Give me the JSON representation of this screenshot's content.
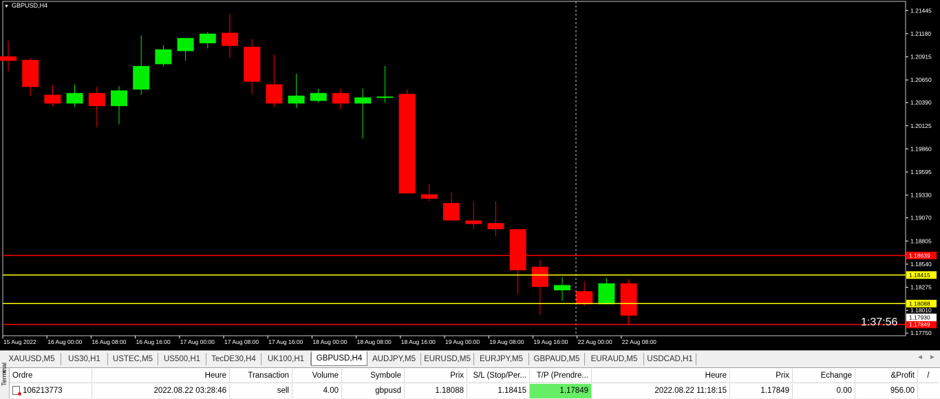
{
  "chart": {
    "title": "GBPUSD,H4",
    "timer": "1:37:56",
    "colors": {
      "bull": "#00ee00",
      "bear": "#ff0000",
      "wick_bull": "#00ee00",
      "wick_bear": "#ff0000",
      "level_red": "#ff0000",
      "level_yellow": "#ffff00",
      "axis": "#ffffff"
    },
    "price_labels": [
      "1.21445",
      "1.21180",
      "1.20915",
      "1.20650",
      "1.20390",
      "1.20125",
      "1.19860",
      "1.19595",
      "1.19330",
      "1.19070",
      "1.18805",
      "1.18540",
      "1.18275",
      "1.18010",
      "1.17750"
    ],
    "time_labels": [
      "15 Aug 2022",
      "16 Aug 00:00",
      "16 Aug 08:00",
      "16 Aug 16:00",
      "17 Aug 00:00",
      "17 Aug 08:00",
      "17 Aug 16:00",
      "18 Aug 00:00",
      "18 Aug 08:00",
      "18 Aug 16:00",
      "19 Aug 00:00",
      "19 Aug 08:00",
      "19 Aug 16:00",
      "22 Aug 00:00",
      "22 Aug 08:00"
    ],
    "levels": [
      {
        "price": 1.18639,
        "label": "1.18639",
        "color": "red"
      },
      {
        "price": 1.18415,
        "label": "1.18415",
        "color": "yellow"
      },
      {
        "price": 1.18088,
        "label": "1.18088",
        "color": "yellow"
      },
      {
        "price": 1.17849,
        "label": "1.17849",
        "color": "red"
      }
    ],
    "current_price": {
      "price": 1.1793,
      "label": "1.17930"
    }
  },
  "chart_data": {
    "type": "candlestick",
    "title": "GBPUSD,H4",
    "ylim": [
      1.1772,
      1.2155
    ],
    "candles": [
      {
        "o": 1.2092,
        "h": 1.211,
        "l": 1.2075,
        "c": 1.2087
      },
      {
        "o": 1.2088,
        "h": 1.209,
        "l": 1.2047,
        "c": 1.2057
      },
      {
        "o": 1.2048,
        "h": 1.2059,
        "l": 1.2035,
        "c": 1.2038
      },
      {
        "o": 1.2038,
        "h": 1.206,
        "l": 1.2034,
        "c": 1.205
      },
      {
        "o": 1.205,
        "h": 1.2057,
        "l": 1.2011,
        "c": 1.2035
      },
      {
        "o": 1.2035,
        "h": 1.2058,
        "l": 1.2014,
        "c": 1.2053
      },
      {
        "o": 1.2054,
        "h": 1.2116,
        "l": 1.2048,
        "c": 1.2081
      },
      {
        "o": 1.2083,
        "h": 1.2105,
        "l": 1.208,
        "c": 1.21
      },
      {
        "o": 1.2098,
        "h": 1.2113,
        "l": 1.2087,
        "c": 1.2113
      },
      {
        "o": 1.2107,
        "h": 1.212,
        "l": 1.2101,
        "c": 1.2118
      },
      {
        "o": 1.2119,
        "h": 1.2141,
        "l": 1.209,
        "c": 1.2104
      },
      {
        "o": 1.2103,
        "h": 1.2112,
        "l": 1.2049,
        "c": 1.2063
      },
      {
        "o": 1.206,
        "h": 1.2094,
        "l": 1.2034,
        "c": 1.2038
      },
      {
        "o": 1.2038,
        "h": 1.2072,
        "l": 1.2033,
        "c": 1.2047
      },
      {
        "o": 1.2041,
        "h": 1.2055,
        "l": 1.2039,
        "c": 1.205
      },
      {
        "o": 1.205,
        "h": 1.2055,
        "l": 1.2031,
        "c": 1.2038
      },
      {
        "o": 1.2038,
        "h": 1.2055,
        "l": 1.1998,
        "c": 1.2045
      },
      {
        "o": 1.2045,
        "h": 1.2081,
        "l": 1.2039,
        "c": 1.2046
      },
      {
        "o": 1.2049,
        "h": 1.2054,
        "l": 1.1935,
        "c": 1.1935
      },
      {
        "o": 1.1934,
        "h": 1.1946,
        "l": 1.1926,
        "c": 1.1929
      },
      {
        "o": 1.1924,
        "h": 1.1936,
        "l": 1.1905,
        "c": 1.1904
      },
      {
        "o": 1.1904,
        "h": 1.1926,
        "l": 1.1894,
        "c": 1.19
      },
      {
        "o": 1.1901,
        "h": 1.1926,
        "l": 1.1886,
        "c": 1.1894
      },
      {
        "o": 1.1894,
        "h": 1.1894,
        "l": 1.182,
        "c": 1.1847
      },
      {
        "o": 1.1851,
        "h": 1.1859,
        "l": 1.1796,
        "c": 1.1828
      },
      {
        "o": 1.1824,
        "h": 1.1839,
        "l": 1.1812,
        "c": 1.183
      },
      {
        "o": 1.1823,
        "h": 1.1834,
        "l": 1.1806,
        "c": 1.1808
      },
      {
        "o": 1.1808,
        "h": 1.1838,
        "l": 1.1808,
        "c": 1.1832
      },
      {
        "o": 1.1832,
        "h": 1.1837,
        "l": 1.1784,
        "c": 1.1795
      }
    ]
  },
  "tabs": [
    {
      "label": "XAUUSD,M5"
    },
    {
      "label": "US30,H1"
    },
    {
      "label": "USTEC,M5"
    },
    {
      "label": "US500,H1"
    },
    {
      "label": "TecDE30,H4"
    },
    {
      "label": "UK100,H1"
    },
    {
      "label": "GBPUSD,H4",
      "active": true
    },
    {
      "label": "AUDJPY,M5"
    },
    {
      "label": "EURUSD,M5"
    },
    {
      "label": "EURJPY,M5"
    },
    {
      "label": "GBPAUD,M5"
    },
    {
      "label": "EURAUD,M5"
    },
    {
      "label": "USDCAD,H1"
    }
  ],
  "tab_scroll": {
    "left": "◄",
    "right": "►"
  },
  "terminal": {
    "close": "×",
    "side_label": "Terminal",
    "headers": {
      "ordre": "Ordre",
      "heure": "Heure",
      "transaction": "Transaction",
      "volume": "Volume",
      "symbole": "Symbole",
      "prix": "Prix",
      "sl": "S/L (Stop/Per...",
      "tp": "T/P (Prendre...",
      "heure2": "Heure",
      "prix2": "Prix",
      "echange": "Echange",
      "profit": "&Profit",
      "sort": "/"
    },
    "row": {
      "ordre": "106213773",
      "heure": "2022.08.22 03:28:46",
      "transaction": "sell",
      "volume": "4.00",
      "symbole": "gbpusd",
      "prix": "1.18088",
      "sl": "1.18415",
      "tp": "1.17849",
      "heure2": "2022.08.22 11:18:15",
      "prix2": "1.17849",
      "echange": "0.00",
      "profit": "956.00"
    }
  }
}
